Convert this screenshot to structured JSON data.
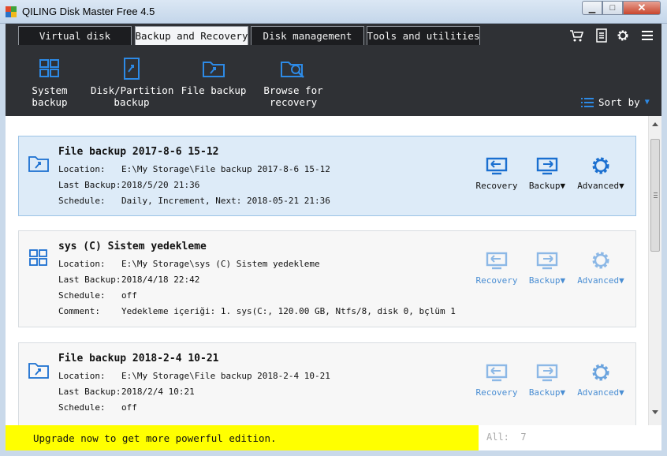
{
  "window": {
    "title": "QILING Disk Master Free 4.5"
  },
  "tabs": [
    {
      "label": "Virtual disk",
      "active": false
    },
    {
      "label": "Backup and Recovery",
      "active": true
    },
    {
      "label": "Disk management",
      "active": false
    },
    {
      "label": "Tools and utilities",
      "active": false
    }
  ],
  "header_icons": [
    "cart-icon",
    "list-icon",
    "gear-icon",
    "menu-icon"
  ],
  "toolbar": {
    "system_backup": "System backup",
    "disk_partition_backup": "Disk/Partition backup",
    "file_backup": "File backup",
    "browse_for_recovery": "Browse for recovery",
    "sort_by": "Sort by"
  },
  "labels": {
    "location": "Location:",
    "last_backup": "Last Backup:",
    "schedule": "Schedule:",
    "comment": "Comment:"
  },
  "actions": {
    "recovery": "Recovery",
    "backup": "Backup▼",
    "advanced": "Advanced▼"
  },
  "backups": [
    {
      "title": "File backup 2017-8-6 15-12",
      "icon": "folder-backup-icon",
      "location": "E:\\My Storage\\File backup 2017-8-6 15-12",
      "last_backup": "2018/5/20 21:36",
      "schedule": "Daily, Increment, Next: 2018-05-21 21:36",
      "selected": true
    },
    {
      "title": "sys (C) Sistem yedekleme",
      "icon": "system-backup-icon",
      "location": "E:\\My Storage\\sys (C) Sistem yedekleme",
      "last_backup": "2018/4/18 22:42",
      "schedule": "off",
      "comment": "Yedekleme içeriği:  1. sys(C:, 120.00 GB, Ntfs/8, disk 0, bçlüm 1",
      "selected": false
    },
    {
      "title": "File backup 2018-2-4 10-21",
      "icon": "folder-backup-icon",
      "location": "E:\\My Storage\\File backup 2018-2-4 10-21",
      "last_backup": "2018/2/4 10:21",
      "schedule": "off",
      "selected": false
    }
  ],
  "status": {
    "upgrade_text": "Upgrade now to get more powerful edition.",
    "all_label": "All:",
    "all_count": "7"
  },
  "colors": {
    "accent": "#1a6fd0",
    "dim_accent": "#4a8ed3",
    "upgrade_bg": "#ffff00",
    "dark_bg": "#2f3135"
  }
}
